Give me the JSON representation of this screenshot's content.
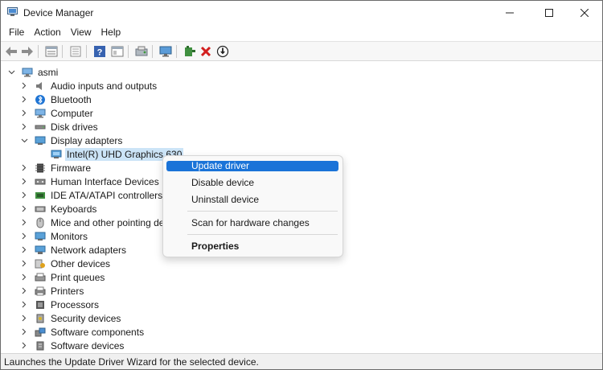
{
  "window": {
    "title": "Device Manager"
  },
  "menubar": {
    "items": [
      "File",
      "Action",
      "View",
      "Help"
    ]
  },
  "toolbar": {
    "buttons": [
      "back-arrow-icon",
      "forward-arrow-icon",
      "properties-icon",
      "list-icon",
      "help-icon",
      "view-icon",
      "scan-icon",
      "monitor-icon",
      "add-driver-icon",
      "uninstall-icon",
      "update-icon"
    ]
  },
  "tree": {
    "root": "asmi",
    "categories": [
      "Audio inputs and outputs",
      "Bluetooth",
      "Computer",
      "Disk drives",
      "Display adapters",
      "Firmware",
      "Human Interface Devices",
      "IDE ATA/ATAPI controllers",
      "Keyboards",
      "Mice and other pointing dev",
      "Monitors",
      "Network adapters",
      "Other devices",
      "Print queues",
      "Printers",
      "Processors",
      "Security devices",
      "Software components",
      "Software devices"
    ],
    "expanded_child": "Intel(R) UHD Graphics 630"
  },
  "context_menu": {
    "items": [
      "Update driver",
      "Disable device",
      "Uninstall device",
      "Scan for hardware changes",
      "Properties"
    ]
  },
  "statusbar": {
    "text": "Launches the Update Driver Wizard for the selected device."
  },
  "colors": {
    "accent": "#1a73d8",
    "selection": "#cce4f7"
  }
}
